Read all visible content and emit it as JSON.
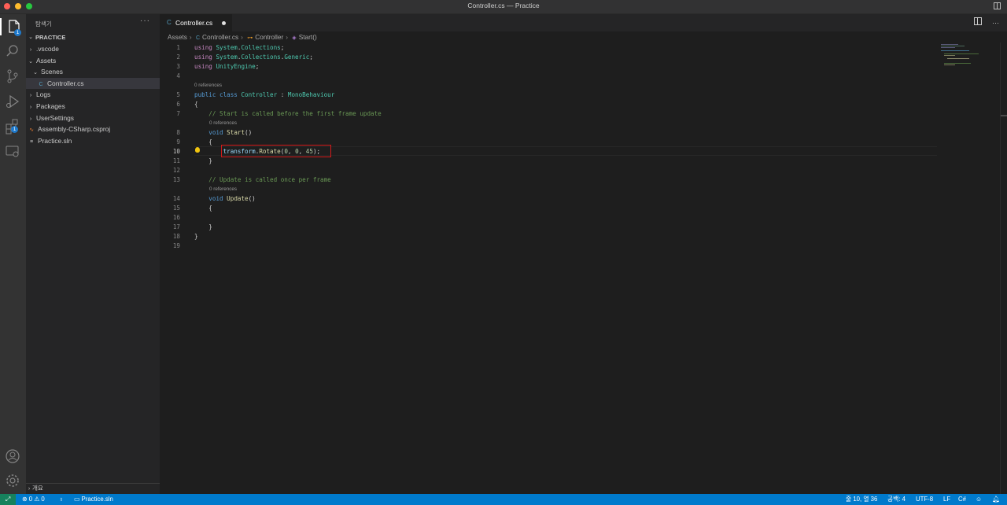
{
  "window": {
    "title": "Controller.cs — Practice"
  },
  "activity_bar": {
    "explorer_badge": "1",
    "extensions_badge": "1"
  },
  "sidebar": {
    "title": "탐색기",
    "more": "···",
    "section": "PRACTICE",
    "tree": [
      {
        "label": ".vscode",
        "type": "folder",
        "expanded": false
      },
      {
        "label": "Assets",
        "type": "folder",
        "expanded": true
      },
      {
        "label": "Scenes",
        "type": "folder",
        "expanded": true
      },
      {
        "label": "Controller.cs",
        "type": "file",
        "icon": "C#"
      },
      {
        "label": "Logs",
        "type": "folder",
        "expanded": false
      },
      {
        "label": "Packages",
        "type": "folder",
        "expanded": false
      },
      {
        "label": "UserSettings",
        "type": "folder",
        "expanded": false
      },
      {
        "label": "Assembly-CSharp.csproj",
        "type": "file",
        "icon": "rss"
      },
      {
        "label": "Practice.sln",
        "type": "file",
        "icon": "lines"
      }
    ],
    "outline": "개요"
  },
  "tabs": [
    {
      "label": "Controller.cs",
      "modified": true
    }
  ],
  "breadcrumb": [
    "Assets",
    "Controller.cs",
    "Controller",
    "Start()"
  ],
  "editor": {
    "references_label": "0 references",
    "lines": {
      "1": "using System.Collections;",
      "2": "using System.Collections.Generic;",
      "3": "using UnityEngine;",
      "5": "public class Controller : MonoBehaviour",
      "6": "{",
      "7": "    // Start is called before the first frame update",
      "8": "    void Start()",
      "9": "    {",
      "10": "        transform.Rotate(0, 0, 45);",
      "11": "    }",
      "13": "    // Update is called once per frame",
      "14": "    void Update()",
      "15": "    {",
      "17": "    }",
      "18": "}"
    },
    "line_numbers": [
      "1",
      "2",
      "3",
      "4",
      "5",
      "6",
      "7",
      "8",
      "9",
      "10",
      "11",
      "12",
      "13",
      "14",
      "15",
      "16",
      "17",
      "18",
      "19"
    ],
    "active_line": "10"
  },
  "status_bar": {
    "errors": "0",
    "warnings": "0",
    "solution": "Practice.sln",
    "position": "줄 10, 열 36",
    "spaces": "공백: 4",
    "encoding": "UTF-8",
    "eol": "LF",
    "language": "C#"
  },
  "colors": {
    "accent": "#007acc",
    "highlight_box": "#d41a1a",
    "remote": "#16825d"
  }
}
